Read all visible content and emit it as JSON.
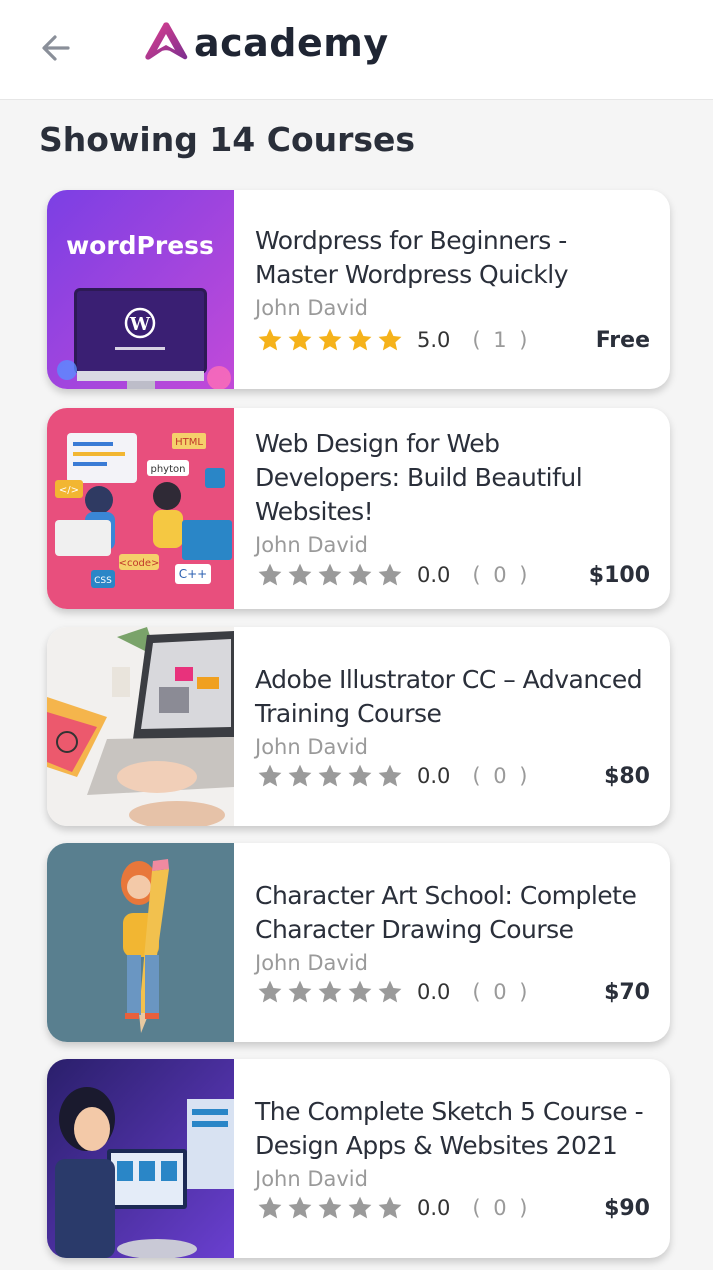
{
  "appbar": {
    "back_icon": "back-arrow-icon",
    "logo_icon": "academy-logo-icon",
    "logo_text": "academy"
  },
  "heading": "Showing 14 Courses",
  "colors": {
    "star_filled": "#f5b21b",
    "star_empty": "#9a9a9a",
    "accent": "#c4389a"
  },
  "courses": [
    {
      "thumb_text": "wordPress",
      "title": "Wordpress for Beginners - Master Wordpress Quickly",
      "author": "John David",
      "rating": 5,
      "rating_text": "5.0",
      "count": "( 1 )",
      "price": "Free"
    },
    {
      "thumb_labels": [
        "HTML",
        "phyton",
        "</>",
        "<code>",
        "C++",
        "CSS"
      ],
      "title": "Web Design for Web Developers: Build Beautiful Websites!",
      "author": "John David",
      "rating": 0,
      "rating_text": "0.0",
      "count": "( 0 )",
      "price": "$100"
    },
    {
      "title": "Adobe Illustrator CC – Advanced Training Course",
      "author": "John David",
      "rating": 0,
      "rating_text": "0.0",
      "count": "( 0 )",
      "price": "$80"
    },
    {
      "title": "Character Art School: Complete Character Drawing Course",
      "author": "John David",
      "rating": 0,
      "rating_text": "0.0",
      "count": "( 0 )",
      "price": "$70"
    },
    {
      "title": "The Complete Sketch 5 Course - Design Apps & Websites 2021",
      "author": "John David",
      "rating": 0,
      "rating_text": "0.0",
      "count": "( 0 )",
      "price": "$90"
    }
  ]
}
